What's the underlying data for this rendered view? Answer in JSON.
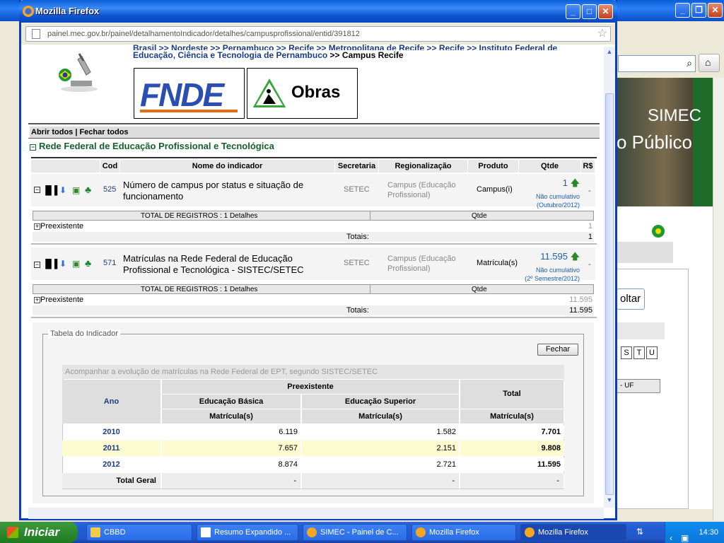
{
  "bg_window": {
    "simec_line1": "SIMEC",
    "simec_line2": "o Público",
    "voltar": "oltar",
    "letters": [
      "S",
      "T",
      "U"
    ],
    "uf_label": "- UF"
  },
  "taskbar": {
    "start": "Iniciar",
    "tasks": [
      "CBBD",
      "Resumo Expandido ...",
      "SIMEC - Painel de C...",
      "Mozilla Firefox",
      "Mozilla Firefox"
    ],
    "clock": "14:30"
  },
  "popup": {
    "title": "Mozilla Firefox",
    "url": "painel.mec.gov.br/painel/detalhamentoIndicador/detalhes/campusprofissional/entid/391812",
    "breadcrumb_line1": "Brasil >> Nordeste >> Pernambuco >> Recife >> Metropolitana de Recife >> Recife >> Instituto Federal de",
    "breadcrumb_line2_link": "Educação, Ciência e Tecnologia de Pernambuco",
    "breadcrumb_current": ">> Campus Recife",
    "logo_fnde": "FNDE",
    "logo_obras": "Obras",
    "abrir_fechar": "Abrir todos | Fechar todos",
    "section_title": "Rede Federal de Educação Profissional e Tecnológica",
    "columns": [
      "Cod",
      "Nome do indicador",
      "Secretaria",
      "Regionalização",
      "Produto",
      "Qtde",
      "R$"
    ],
    "indicators": [
      {
        "cod": "525",
        "name_line1": "Número de campus por status e situação de",
        "name_line2": "funcionamento",
        "secretaria": "SETEC",
        "reg_line1": "Campus (Educação",
        "reg_line2": "Profissional)",
        "produto": "Campus(i)",
        "qtde": "1",
        "qtde_note1": "Não cumulativo",
        "qtde_note2": "(Outubro/2012)",
        "rs": "-",
        "total_registros": "TOTAL DE REGISTROS : 1 Detalhes",
        "qtde_header": "Qtde",
        "pre_label": "Preexistente",
        "pre_value": "1",
        "totais_label": "Totais:",
        "totais_value": "1"
      },
      {
        "cod": "571",
        "name_line1": "Matrículas na Rede Federal de Educação",
        "name_line2": "Profissional e Tecnológica - SISTEC/SETEC",
        "secretaria": "SETEC",
        "reg_line1": "Campus (Educação",
        "reg_line2": "Profissional)",
        "produto": "Matrícula(s)",
        "qtde": "11.595",
        "qtde_note1": "Não cumulativo",
        "qtde_note2": "(2º Semestre/2012)",
        "rs": "-",
        "total_registros": "TOTAL DE REGISTROS : 1 Detalhes",
        "qtde_header": "Qtde",
        "pre_label": "Preexistente",
        "pre_value": "11.595",
        "totais_label": "Totais:",
        "totais_value": "11.595"
      }
    ],
    "tabela": {
      "legend": "Tabela do Indicador",
      "fechar": "Fechar",
      "caption": "Acompanhar a evolução de matrículas na Rede Federal de EPT, segundo SISTEC/SETEC",
      "ano": "Ano",
      "preexistente": "Preexistente",
      "total": "Total",
      "basica": "Educação Básica",
      "superior": "Educação Superior",
      "unit": "Matrícula(s)",
      "rows": [
        {
          "ano": "2010",
          "basica": "6.119",
          "superior": "1.582",
          "total": "7.701"
        },
        {
          "ano": "2011",
          "basica": "7.657",
          "superior": "2.151",
          "total": "9.808"
        },
        {
          "ano": "2012",
          "basica": "8.874",
          "superior": "2.721",
          "total": "11.595"
        }
      ],
      "total_geral": "Total Geral",
      "tg_basica": "-",
      "tg_superior": "-",
      "tg_total": "-"
    }
  }
}
